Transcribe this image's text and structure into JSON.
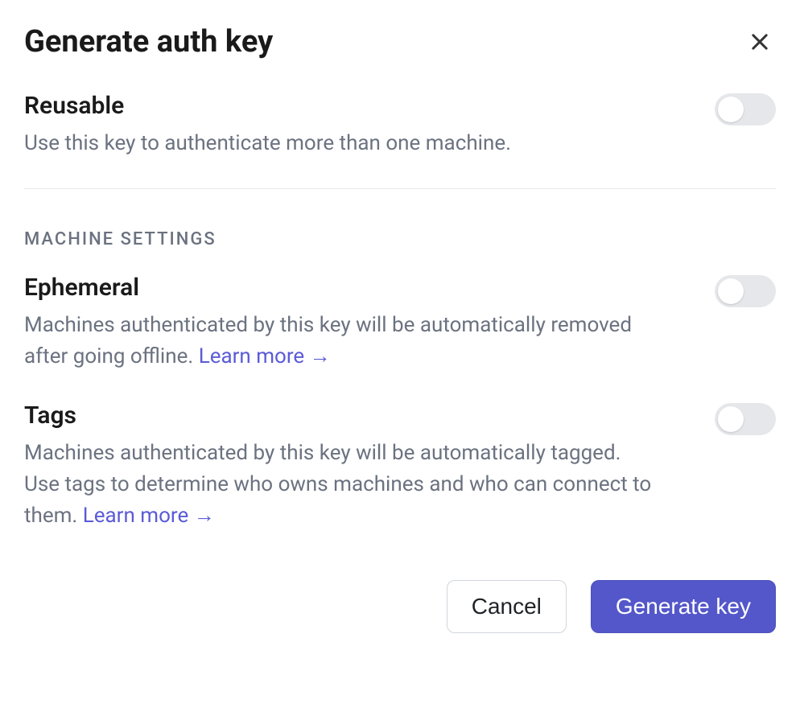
{
  "dialog": {
    "title": "Generate auth key"
  },
  "reusable": {
    "title": "Reusable",
    "description": "Use this key to authenticate more than one machine.",
    "enabled": false
  },
  "section_label": "MACHINE SETTINGS",
  "ephemeral": {
    "title": "Ephemeral",
    "description": "Machines authenticated by this key will be automatically removed after going offline. ",
    "learn_more": "Learn more →",
    "enabled": false
  },
  "tags": {
    "title": "Tags",
    "description": "Machines authenticated by this key will be automatically tagged. Use tags to determine who owns machines and who can connect to them. ",
    "learn_more": "Learn more →",
    "enabled": false
  },
  "footer": {
    "cancel": "Cancel",
    "generate": "Generate key"
  }
}
